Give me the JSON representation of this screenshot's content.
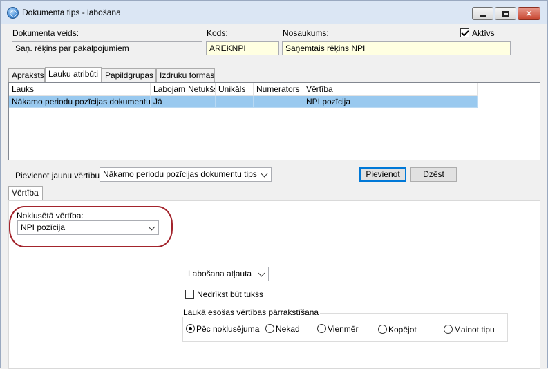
{
  "window": {
    "title": "Dokumenta tips - labošana",
    "controls": {
      "minimize": "minimize",
      "maximize": "maximize",
      "close": "✕"
    }
  },
  "header": {
    "doc_type_label": "Dokumenta veids:",
    "doc_type_value": "Saņ. rēķins par pakalpojumiem",
    "code_label": "Kods:",
    "code_value": "AREKNPI",
    "name_label": "Nosaukums:",
    "name_value": "Saņemtais rēķins NPI",
    "active_label": "Aktīvs",
    "active_checked": true
  },
  "tabs": [
    {
      "label": "Apraksts",
      "active": false
    },
    {
      "label": "Lauku atribūti",
      "active": true
    },
    {
      "label": "Papildgrupas",
      "active": false
    },
    {
      "label": "Izdruku formas",
      "active": false
    }
  ],
  "grid": {
    "columns": [
      "Lauks",
      "Labojams",
      "Netukšs",
      "Unikāls",
      "Numerators",
      "Vērtība"
    ],
    "rows": [
      [
        "Nākamo periodu pozīcijas dokumentu tips",
        "Jā",
        "",
        "",
        "",
        "NPI pozīcija"
      ]
    ]
  },
  "add_value": {
    "label": "Pievienot jaunu vērtību:",
    "selected": "Nākamo periodu pozīcijas dokumentu tips",
    "add_button": "Pievienot",
    "delete_button": "Dzēst"
  },
  "value_tab": {
    "label": "Vērtība"
  },
  "default_value": {
    "label": "Noklusētā vērtība:",
    "selected": "NPI pozīcija"
  },
  "edit_mode": {
    "selected": "Labošana atļauta"
  },
  "not_empty": {
    "label": "Nedrīkst būt tukšs",
    "checked": false
  },
  "overwrite_group": {
    "title": "Laukā esošas vērtības pārrakstīšana",
    "options": [
      {
        "label": "Pēc noklusējuma",
        "checked": true
      },
      {
        "label": "Nekad",
        "checked": false
      },
      {
        "label": "Vienmēr",
        "checked": false
      },
      {
        "label": "Kopējot",
        "checked": false
      },
      {
        "label": "Mainot tipu",
        "checked": false
      }
    ]
  }
}
